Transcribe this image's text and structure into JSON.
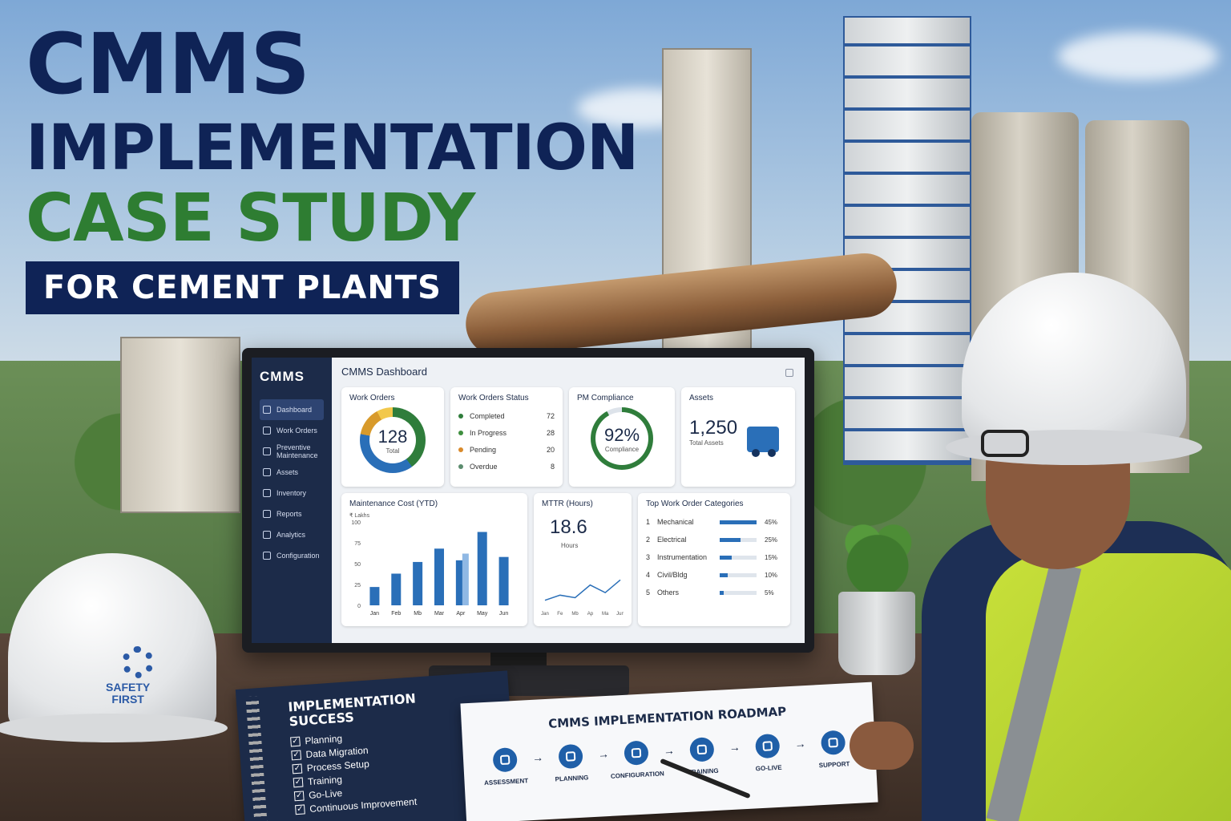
{
  "headline": {
    "line1": "CMMS",
    "line2": "IMPLEMENTATION",
    "line3": "CASE STUDY",
    "subtitle": "FOR CEMENT PLANTS"
  },
  "dashboard": {
    "app_title": "CMMS",
    "page_title": "CMMS Dashboard",
    "sidebar": [
      {
        "label": "Dashboard",
        "active": true,
        "icon": "dashboard-icon"
      },
      {
        "label": "Work Orders",
        "active": false,
        "icon": "clipboard-icon"
      },
      {
        "label": "Preventive Maintenance",
        "active": false,
        "icon": "wrench-icon"
      },
      {
        "label": "Assets",
        "active": false,
        "icon": "building-icon"
      },
      {
        "label": "Inventory",
        "active": false,
        "icon": "box-icon"
      },
      {
        "label": "Reports",
        "active": false,
        "icon": "report-icon"
      },
      {
        "label": "Analytics",
        "active": false,
        "icon": "analytics-icon"
      },
      {
        "label": "Configuration",
        "active": false,
        "icon": "gear-icon"
      }
    ],
    "work_orders": {
      "title": "Work Orders",
      "value": "128",
      "caption": "Total"
    },
    "work_orders_status": {
      "title": "Work Orders Status",
      "items": [
        {
          "label": "Completed",
          "value": "72",
          "color": "#2f7d3b"
        },
        {
          "label": "In Progress",
          "value": "28",
          "color": "#3f8f3f"
        },
        {
          "label": "Pending",
          "value": "20",
          "color": "#d98a2b"
        },
        {
          "label": "Overdue",
          "value": "8",
          "color": "#5b8c6e"
        }
      ]
    },
    "pm_compliance": {
      "title": "PM Compliance",
      "value": "92%",
      "caption": "Compliance",
      "fraction": 0.92
    },
    "assets": {
      "title": "Assets",
      "value": "1,250",
      "caption": "Total Assets"
    },
    "maintenance_cost": {
      "title": "Maintenance Cost (YTD)",
      "unit": "₹ Lakhs"
    },
    "mttr": {
      "title": "MTTR (Hours)",
      "value": "18.6",
      "caption": "Hours"
    },
    "top_categories": {
      "title": "Top Work Order Categories",
      "items": [
        {
          "num": "1",
          "label": "Mechanical",
          "pct": "45%",
          "fraction": 0.45
        },
        {
          "num": "2",
          "label": "Electrical",
          "pct": "25%",
          "fraction": 0.25
        },
        {
          "num": "3",
          "label": "Instrumentation",
          "pct": "15%",
          "fraction": 0.15
        },
        {
          "num": "4",
          "label": "Civil/Bldg",
          "pct": "10%",
          "fraction": 0.1
        },
        {
          "num": "5",
          "label": "Others",
          "pct": "5%",
          "fraction": 0.05
        }
      ]
    }
  },
  "chart_data": [
    {
      "type": "bar",
      "title": "Maintenance Cost (YTD)",
      "ylabel": "₹ Lakhs",
      "categories": [
        "Jan",
        "Feb",
        "Mar",
        "Mar",
        "Apr",
        "May",
        "Jun"
      ],
      "tick_labels": [
        "Jan",
        "Feb",
        "Mb",
        "Mar",
        "Apr",
        "May",
        "Jun"
      ],
      "series": [
        {
          "values": [
            22,
            38,
            52,
            68,
            54,
            88,
            58
          ]
        },
        {
          "values": [
            null,
            null,
            null,
            null,
            62,
            null,
            null
          ]
        }
      ],
      "yticks": [
        0,
        25,
        50,
        75,
        100
      ],
      "ylim": [
        0,
        100
      ],
      "grid": false
    },
    {
      "type": "line",
      "title": "MTTR (Hours)",
      "x": [
        "Jan",
        "Feb",
        "Mar",
        "Apr",
        "May",
        "Jun"
      ],
      "tick_labels": [
        "Jan",
        "Fe",
        "Mb",
        "Ap",
        "Ma",
        "Jun"
      ],
      "series": [
        {
          "values": [
            14,
            16,
            15,
            20,
            17,
            22
          ]
        }
      ],
      "grid": false
    }
  ],
  "notebook": {
    "title_line1": "IMPLEMENTATION",
    "title_line2": "SUCCESS",
    "items": [
      "Planning",
      "Data Migration",
      "Process Setup",
      "Training",
      "Go-Live",
      "Continuous Improvement"
    ]
  },
  "roadmap": {
    "title": "CMMS IMPLEMENTATION ROADMAP",
    "steps": [
      "ASSESSMENT",
      "PLANNING",
      "CONFIGURATION",
      "TRAINING",
      "GO-LIVE",
      "SUPPORT"
    ]
  },
  "hardhat": {
    "line1": "SAFETY",
    "line2": "FIRST"
  }
}
